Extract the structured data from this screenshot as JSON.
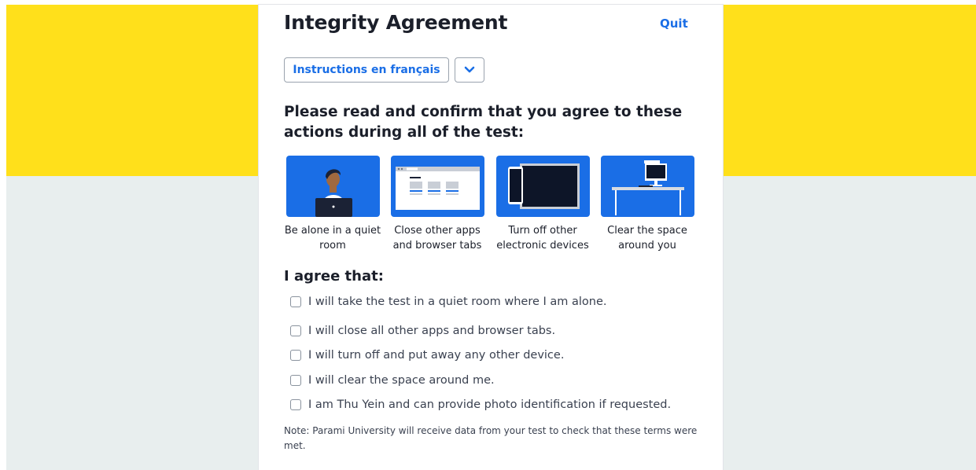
{
  "header": {
    "title": "Integrity Agreement",
    "quit_label": "Quit"
  },
  "language": {
    "button_label": "Instructions en français"
  },
  "intro": {
    "text": "Please read and confirm that you agree to these actions during all of the test:"
  },
  "tiles": [
    {
      "icon": "person-laptop-icon",
      "caption": "Be alone in a quiet room"
    },
    {
      "icon": "browser-tabs-icon",
      "caption": "Close other apps and browser tabs"
    },
    {
      "icon": "devices-icon",
      "caption": "Turn off other electronic devices"
    },
    {
      "icon": "clear-desk-icon",
      "caption": "Clear the space around you"
    }
  ],
  "agreement": {
    "title": "I agree that:",
    "items": [
      {
        "label": "I will take the test in a quiet room where I am alone.",
        "checked": false
      },
      {
        "label": "I will close all other apps and browser tabs.",
        "checked": false
      },
      {
        "label": "I will turn off and put away any other device.",
        "checked": false
      },
      {
        "label": "I will clear the space around me.",
        "checked": false
      },
      {
        "label": "I am Thu Yein and can provide photo identification if requested.",
        "checked": false
      }
    ]
  },
  "note": {
    "text": "Note: Parami University will receive data from your test to check that these terms were met."
  },
  "colors": {
    "accent": "#1a6ee6",
    "banner_yellow": "#ffe01b",
    "page_gray": "#e8eeee"
  }
}
